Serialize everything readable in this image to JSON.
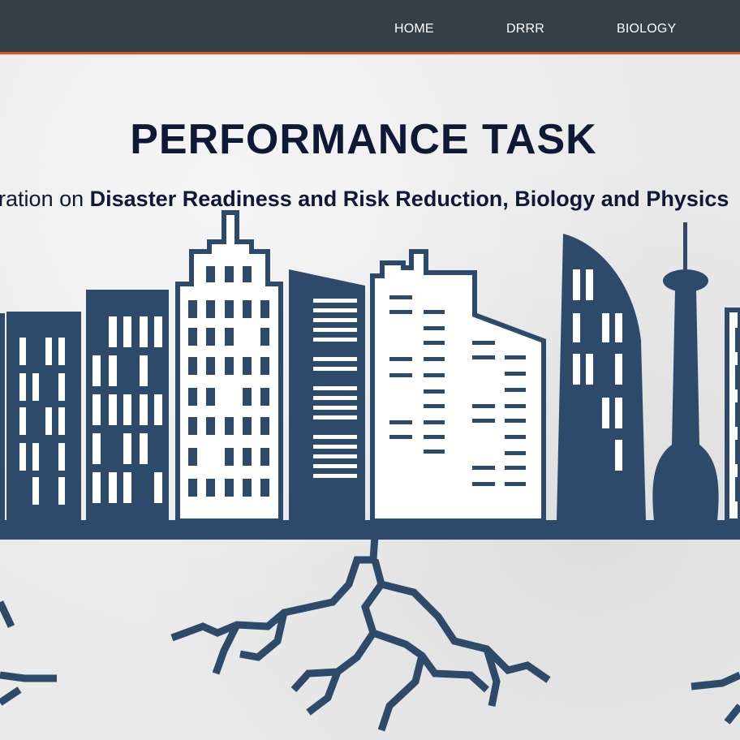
{
  "nav": {
    "items": [
      {
        "label": "HOME"
      },
      {
        "label": "DRRR"
      },
      {
        "label": "BIOLOGY"
      }
    ]
  },
  "hero": {
    "title": "PERFORMANCE TASK",
    "subtitle_lead": "Integration on",
    "subtitle_bold": "Disaster Readiness and Risk Reduction, Biology and Physics"
  },
  "colors": {
    "navbar_bg": "#353f47",
    "navbar_accent": "#e2561c",
    "text_dark": "#0e1a35",
    "illustration_blue": "#2d4a6b",
    "background": "#e9eae9"
  },
  "illustration": {
    "icon": "city-skyline-with-ground-cracks-illustration"
  }
}
